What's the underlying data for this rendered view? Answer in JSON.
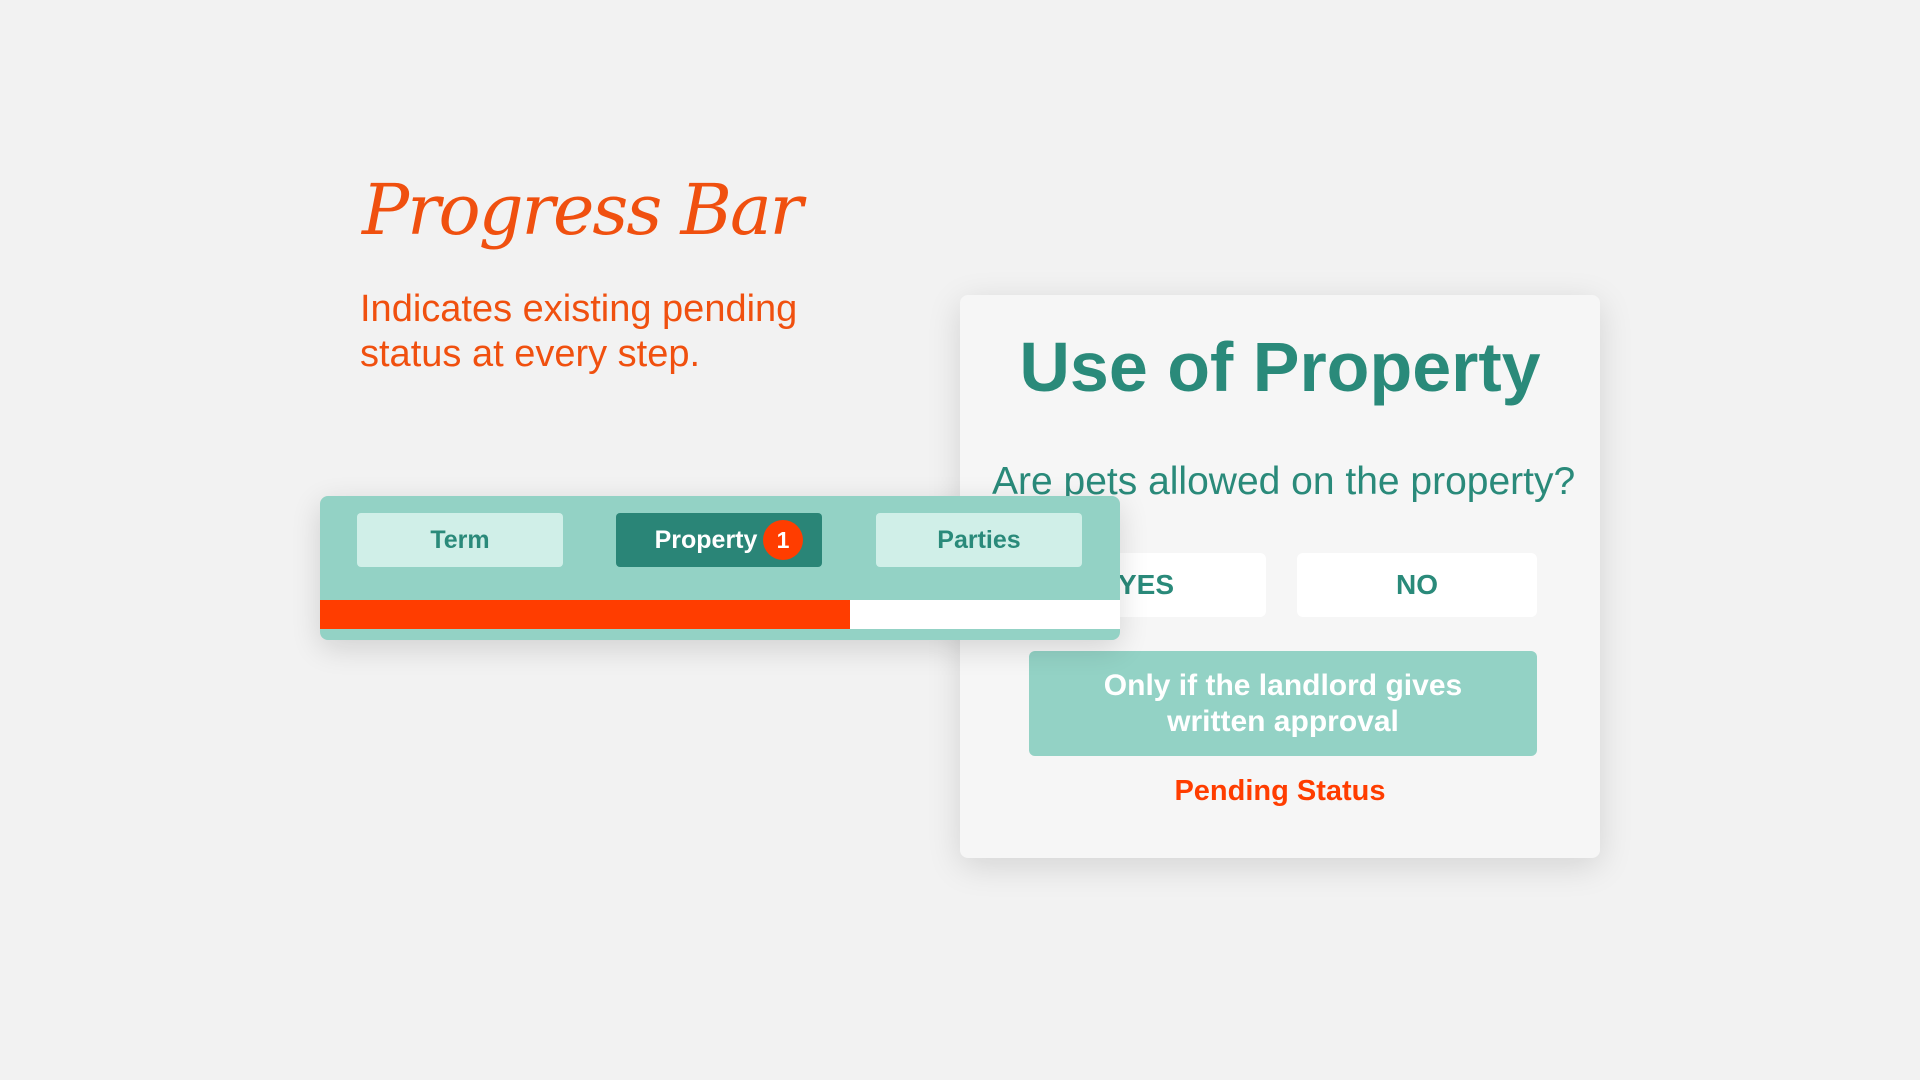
{
  "intro": {
    "title": "Progress Bar",
    "description": "Indicates existing pending status at every step."
  },
  "card": {
    "title": "Use of Property",
    "question": "Are pets allowed on the property?",
    "yes_label": "YES",
    "no_label": "NO",
    "approval_label": "Only if the landlord gives written approval",
    "pending_label": "Pending Status"
  },
  "progress": {
    "steps": [
      {
        "label": "Term"
      },
      {
        "label": "Property",
        "badge": "1",
        "active": true
      },
      {
        "label": "Parties"
      }
    ],
    "fill_fraction": 0.662
  },
  "colors": {
    "accent_orange": "#f0500f",
    "status_red": "#ff3d00",
    "teal_dark": "#2a8577",
    "teal_text": "#2a8a7a",
    "teal_light": "#93d2c5",
    "teal_pale": "#d0efe8",
    "background": "#f2f2f2"
  }
}
